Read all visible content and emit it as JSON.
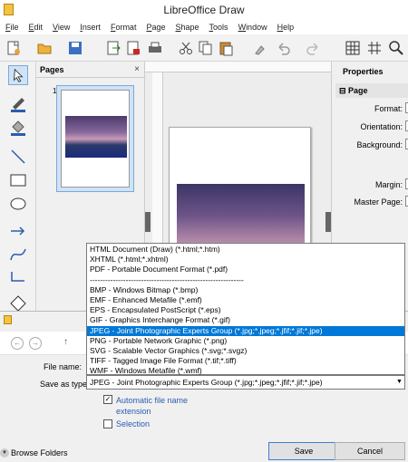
{
  "window": {
    "title": "LibreOffice Draw"
  },
  "menu": [
    "File",
    "Edit",
    "View",
    "Insert",
    "Format",
    "Page",
    "Shape",
    "Tools",
    "Window",
    "Help"
  ],
  "pages_panel": {
    "title": "Pages",
    "close": "×",
    "page_number": "1"
  },
  "properties": {
    "title": "Properties",
    "section": "Page",
    "rows": [
      "Format:",
      "Orientation:",
      "Background:",
      "Margin:",
      "Master Page:"
    ]
  },
  "dialog": {
    "file_name_label": "File name:",
    "file_name_value": "",
    "save_as_type_label": "Save as type:",
    "save_as_type_value": "JPEG - Joint Photographic Experts Group (*.jpg;*.jpeg;*.jfif;*.jif;*.jpe)",
    "auto_extension_label": "Automatic file name extension",
    "auto_extension_checked": "✓",
    "selection_label": "Selection",
    "browse_folders": "Browse Folders",
    "save_button": "Save",
    "cancel_button": "Cancel"
  },
  "dropdown_options": [
    "HTML Document (Draw) (*.html;*.htm)",
    "XHTML (*.html;*.xhtml)",
    "PDF - Portable Document Format (*.pdf)",
    "------------------------------------------------------------",
    "BMP - Windows Bitmap (*.bmp)",
    "EMF - Enhanced Metafile (*.emf)",
    "EPS - Encapsulated PostScript (*.eps)",
    "GIF - Graphics Interchange Format (*.gif)",
    "JPEG - Joint Photographic Experts Group (*.jpg;*.jpeg;*.jfif;*.jif;*.jpe)",
    "PNG - Portable Network Graphic (*.png)",
    "SVG - Scalable Vector Graphics (*.svg;*.svgz)",
    "TIFF - Tagged Image File Format (*.tif;*.tiff)",
    "WMF - Windows Metafile (*.wmf)"
  ],
  "selected_option_index": 8,
  "colors": {
    "selection": "#0078d7",
    "link": "#2a5db0"
  }
}
